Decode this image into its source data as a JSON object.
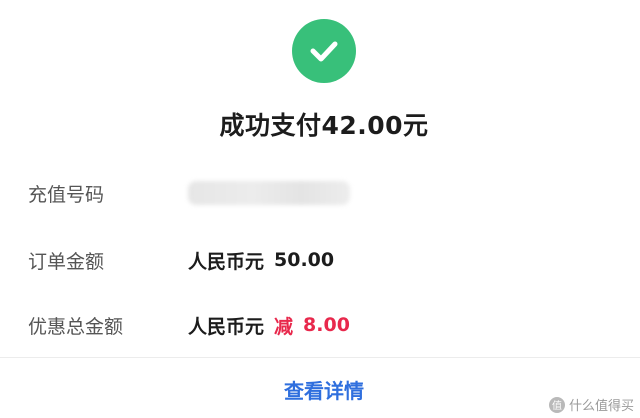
{
  "header": {
    "status_icon": "check-circle-icon",
    "title": "成功支付42.00元"
  },
  "rows": [
    {
      "label": "充值号码",
      "value": ""
    },
    {
      "label": "订单金额",
      "currency": "人民币元",
      "amount": "50.00"
    },
    {
      "label": "优惠总金额",
      "currency": "人民币元",
      "prefix": "减",
      "amount": "8.00"
    }
  ],
  "footer": {
    "details_label": "查看详情"
  },
  "watermark": {
    "text": "什么值得买"
  },
  "colors": {
    "success": "#38c07a",
    "discount": "#e8284c",
    "link": "#2f6fde"
  }
}
